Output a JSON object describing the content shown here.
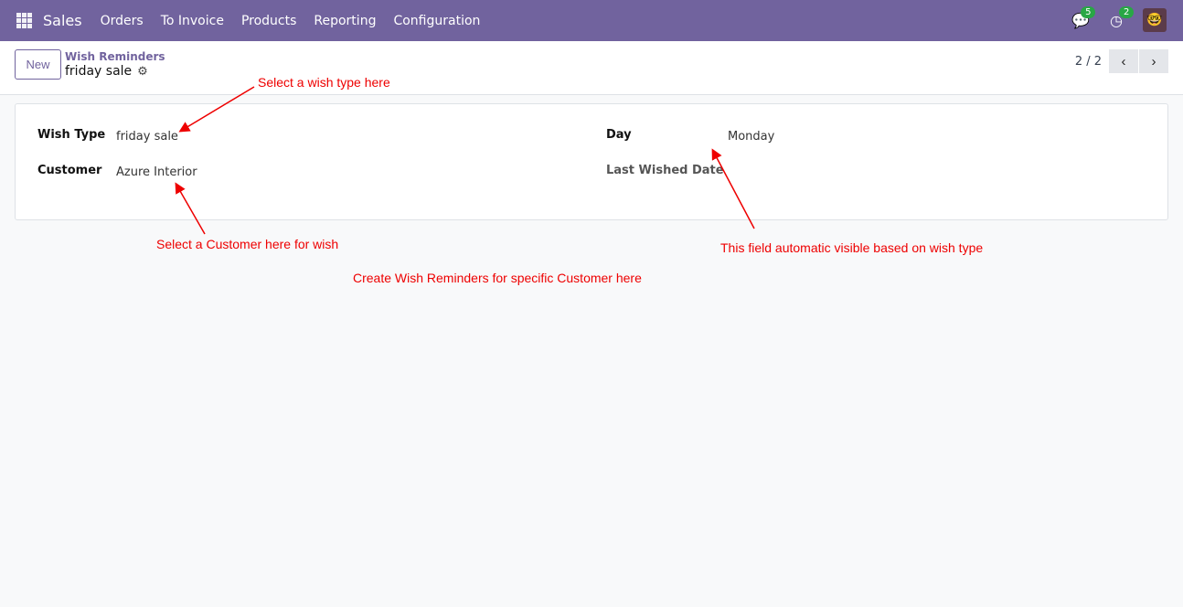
{
  "nav": {
    "app": "Sales",
    "menu": [
      "Orders",
      "To Invoice",
      "Products",
      "Reporting",
      "Configuration"
    ],
    "messages_count": "5",
    "activities_count": "2"
  },
  "control": {
    "new_label": "New",
    "breadcrumb_parent": "Wish Reminders",
    "breadcrumb_current": "friday sale",
    "pager": "2 / 2"
  },
  "form": {
    "wish_type_label": "Wish Type",
    "wish_type": "friday sale",
    "customer_label": "Customer",
    "customer": "Azure Interior",
    "day_label": "Day",
    "day": "Monday",
    "last_wished_label": "Last Wished Date"
  },
  "annotations": {
    "wish_type": "Select a wish type here",
    "customer": "Select a Customer here for wish",
    "day": "This field automatic visible based on wish type",
    "general": "Create Wish Reminders for specific Customer here"
  }
}
